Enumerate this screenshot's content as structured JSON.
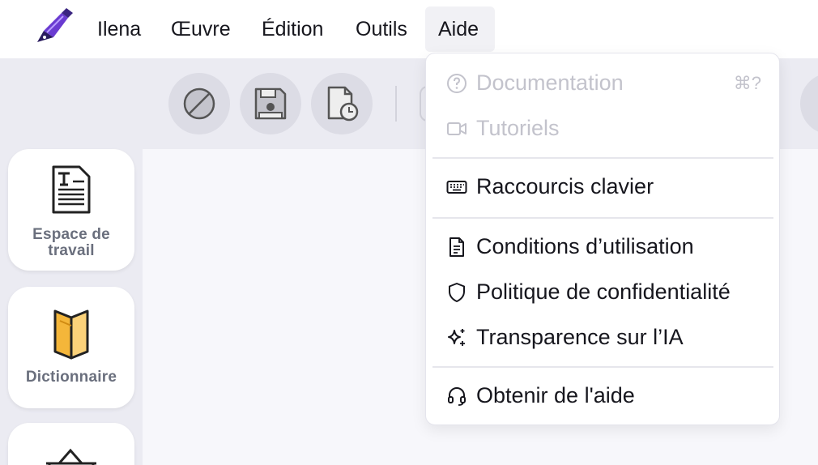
{
  "menubar": {
    "logo_icon": "fountain-pen-icon",
    "items": [
      {
        "label": "Ilena"
      },
      {
        "label": "Œuvre"
      },
      {
        "label": "Édition"
      },
      {
        "label": "Outils"
      },
      {
        "label": "Aide",
        "active": true
      }
    ]
  },
  "toolbar": {
    "buttons": [
      {
        "icon": "disabled-circle-icon"
      },
      {
        "icon": "floppy-disk-icon"
      },
      {
        "icon": "document-history-icon"
      }
    ]
  },
  "sidebar": {
    "items": [
      {
        "label": "Espace de travail",
        "icon": "text-document-icon"
      },
      {
        "label": "Dictionnaire",
        "icon": "book-icon"
      },
      {
        "label": "",
        "icon": "basket-icon"
      }
    ]
  },
  "help_menu": {
    "items": [
      {
        "label": "Documentation",
        "icon": "question-circle-icon",
        "shortcut": "⌘?",
        "disabled": true
      },
      {
        "label": "Tutoriels",
        "icon": "video-camera-icon",
        "disabled": true
      },
      {
        "label": "Raccourcis clavier",
        "icon": "keyboard-icon"
      },
      {
        "label": "Conditions d’utilisation",
        "icon": "file-text-icon"
      },
      {
        "label": "Politique de confidentialité",
        "icon": "shield-icon"
      },
      {
        "label": "Transparence sur l’IA",
        "icon": "sparkles-icon"
      },
      {
        "label": "Obtenir de l'aide",
        "icon": "headset-icon"
      }
    ]
  }
}
